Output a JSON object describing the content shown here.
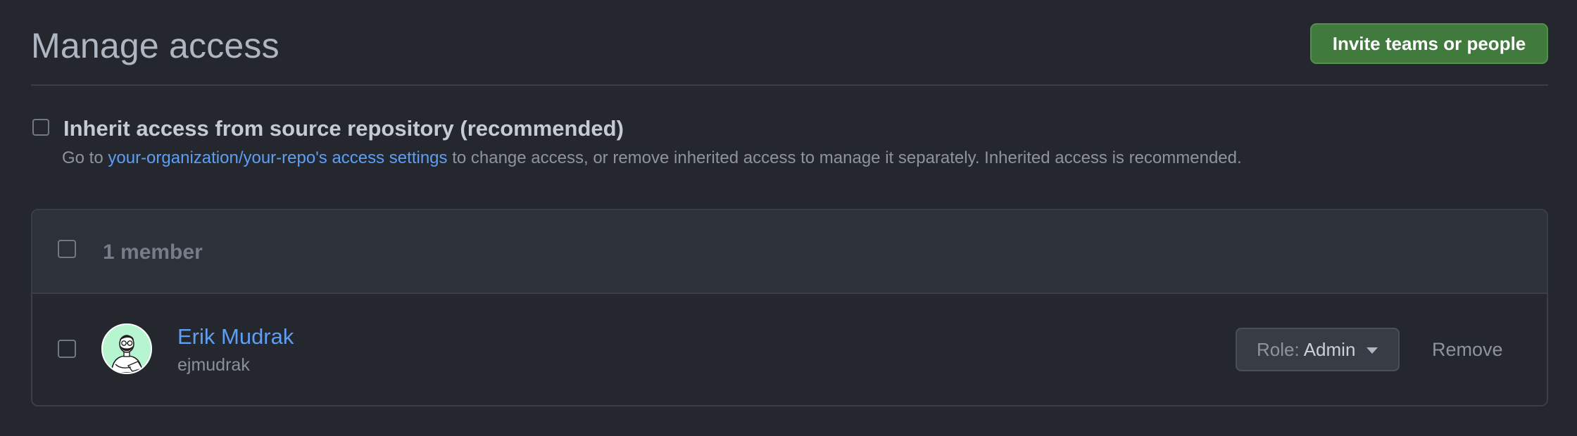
{
  "header": {
    "title": "Manage access",
    "invite_button": "Invite teams or people"
  },
  "inherit": {
    "title": "Inherit access from source repository (recommended)",
    "desc_prefix": "Go to ",
    "link_text": "your-organization/your-repo's access settings",
    "desc_suffix": " to change access, or remove inherited access to manage it separately. Inherited access is recommended.",
    "checked": false
  },
  "members": {
    "count_label": "1 member",
    "rows": [
      {
        "name": "Erik Mudrak",
        "login": "ejmudrak",
        "role_prefix": "Role:",
        "role_value": "Admin",
        "remove_label": "Remove",
        "avatar_icon": "illustrated-person-avatar-icon"
      }
    ]
  },
  "colors": {
    "background": "#24272e",
    "accent_green": "#417a3d",
    "link_blue": "#5e9ef3"
  }
}
